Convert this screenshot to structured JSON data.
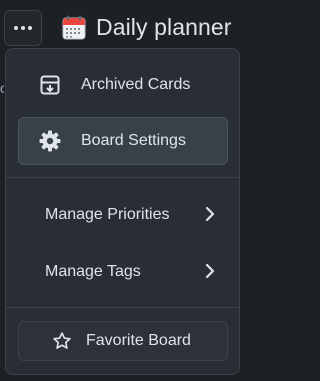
{
  "header": {
    "more_button": "more-options",
    "board_title": "Daily planner",
    "board_icon": "calendar-icon"
  },
  "side_text": "o",
  "menu": {
    "archived_cards": "Archived Cards",
    "board_settings": "Board Settings",
    "manage_priorities": "Manage Priorities",
    "manage_tags": "Manage Tags",
    "favorite_board": "Favorite Board"
  },
  "colors": {
    "background": "#1d2125",
    "menu_bg": "#282e33",
    "active_item_bg": "#38414a",
    "text": "#dee4ea",
    "calendar_red": "#e8473f"
  }
}
